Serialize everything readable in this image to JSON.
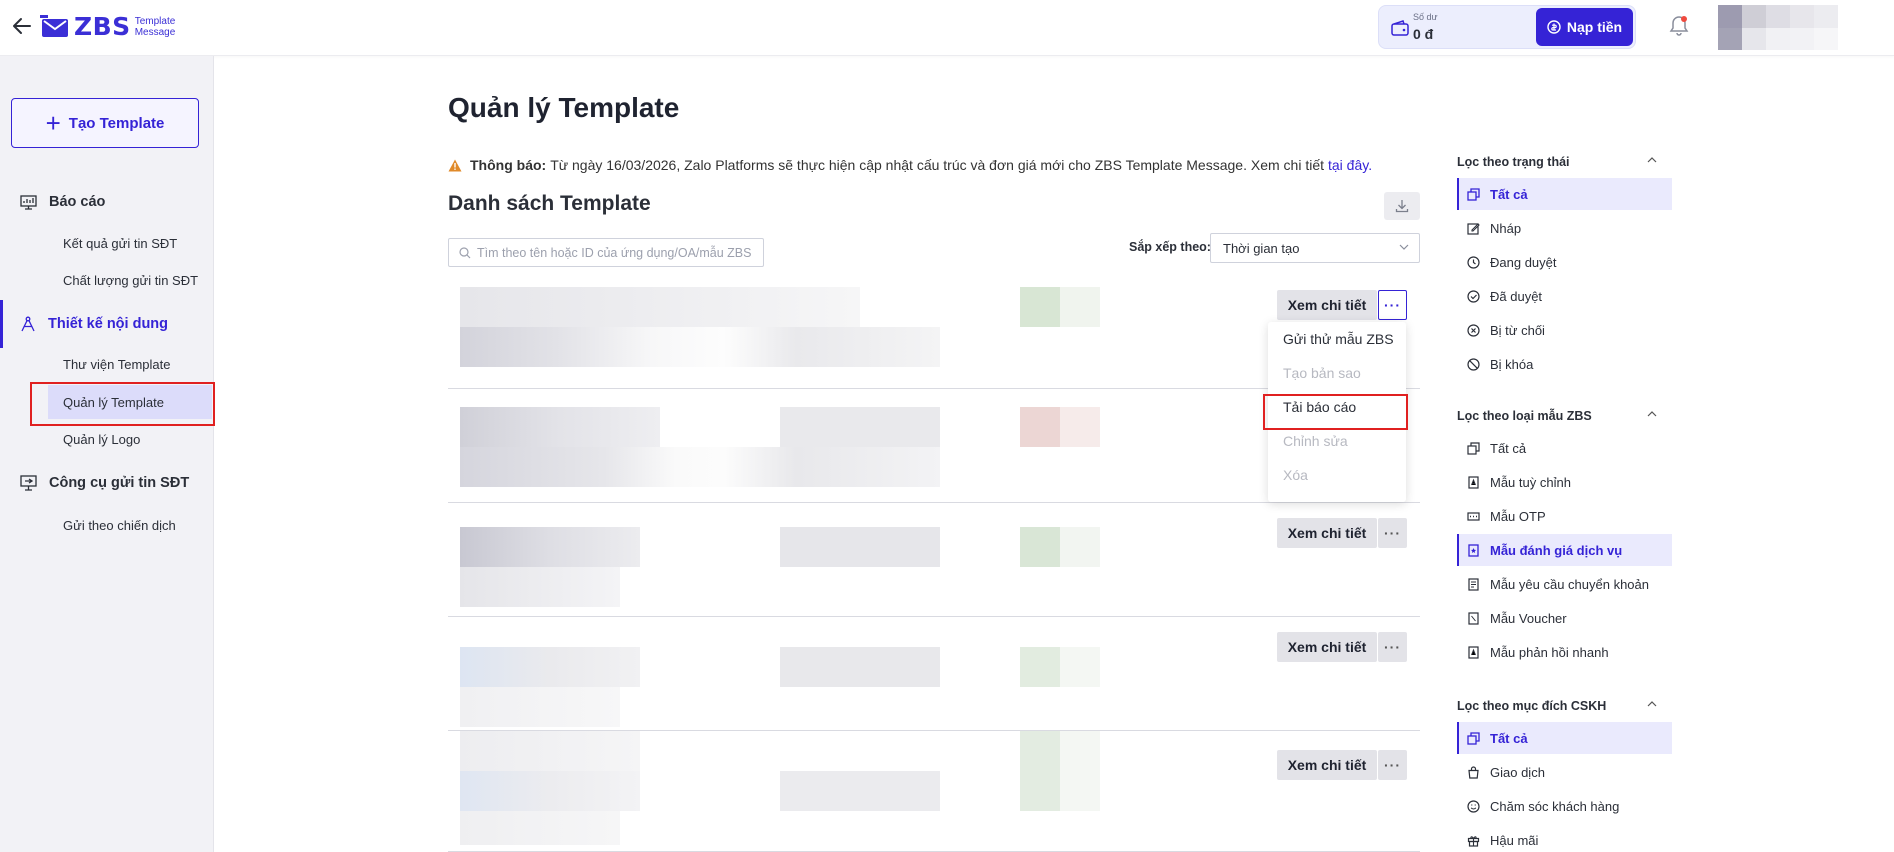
{
  "header": {
    "logo_text": "ZBS",
    "logo_sub_line1": "Template",
    "logo_sub_line2": "Message",
    "balance_label": "Số dư",
    "balance_value": "0 đ",
    "topup_label": "Nạp tiền"
  },
  "sidebar": {
    "create_label": "Tạo Template",
    "groups": [
      {
        "label": "Báo cáo",
        "items": [
          "Kết quả gửi tin SĐT",
          "Chất lượng gửi tin SĐT"
        ]
      },
      {
        "label": "Thiết kế nội dung",
        "items": [
          "Thư viện Template",
          "Quản lý Template",
          "Quản lý Logo"
        ]
      },
      {
        "label": "Công cụ gửi tin SĐT",
        "items": [
          "Gửi theo chiến dịch"
        ]
      }
    ],
    "active_group": "Thiết kế nội dung",
    "active_item": "Quản lý Template"
  },
  "main": {
    "title": "Quản lý Template",
    "notice_bold": "Thông báo:",
    "notice_text": "Từ ngày 16/03/2026, Zalo Platforms sẽ thực hiện cập nhật cấu trúc và đơn giá mới cho ZBS Template Message. Xem chi tiết",
    "notice_link": "tại đây.",
    "list_title": "Danh sách Template",
    "search_placeholder": "Tìm theo tên hoặc ID của ứng dụng/OA/mẫu ZBS",
    "sort_label": "Sắp xếp theo:",
    "sort_value": "Thời gian tạo",
    "detail_label": "Xem chi tiết",
    "more_label": "···",
    "row_count": 5
  },
  "dropdown": {
    "items": [
      {
        "label": "Gửi thử mẫu ZBS",
        "disabled": false
      },
      {
        "label": "Tạo bản sao",
        "disabled": true
      },
      {
        "label": "Tải báo cáo",
        "disabled": false
      },
      {
        "label": "Chỉnh sửa",
        "disabled": true
      },
      {
        "label": "Xóa",
        "disabled": true
      }
    ],
    "highlighted": "Tải báo cáo"
  },
  "filters": {
    "status": {
      "title": "Lọc theo trạng thái",
      "items": [
        "Tất cả",
        "Nháp",
        "Đang duyệt",
        "Đã duyệt",
        "Bị từ chối",
        "Bị khóa"
      ],
      "active": "Tất cả"
    },
    "type": {
      "title": "Lọc theo loại mẫu ZBS",
      "items": [
        "Tất cả",
        "Mẫu tuỳ chỉnh",
        "Mẫu OTP",
        "Mẫu đánh giá dịch vụ",
        "Mẫu yêu cầu chuyển khoản",
        "Mẫu Voucher",
        "Mẫu phản hồi nhanh"
      ],
      "active": "Mẫu đánh giá dịch vụ"
    },
    "purpose": {
      "title": "Lọc theo mục đích CSKH",
      "items": [
        "Tất cả",
        "Giao dịch",
        "Chăm sóc khách hàng",
        "Hậu mãi"
      ],
      "active": "Tất cả"
    }
  },
  "colors": {
    "accent": "#3523d6",
    "highlight_box": "#e02020",
    "sidebar_bg": "#f2f2f6"
  }
}
